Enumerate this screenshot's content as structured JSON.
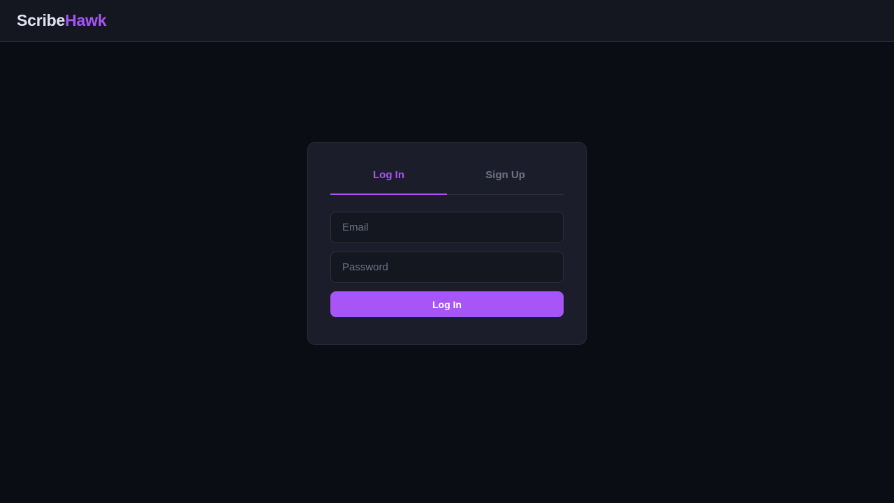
{
  "brand": {
    "name_part1": "Scribe",
    "name_part2": "Hawk",
    "accent_color": "#a855f7"
  },
  "auth": {
    "tabs": [
      {
        "label": "Log In",
        "active": true
      },
      {
        "label": "Sign Up",
        "active": false
      }
    ],
    "email": {
      "placeholder": "Email",
      "value": ""
    },
    "password": {
      "placeholder": "Password",
      "value": ""
    },
    "submit_label": "Log In"
  }
}
